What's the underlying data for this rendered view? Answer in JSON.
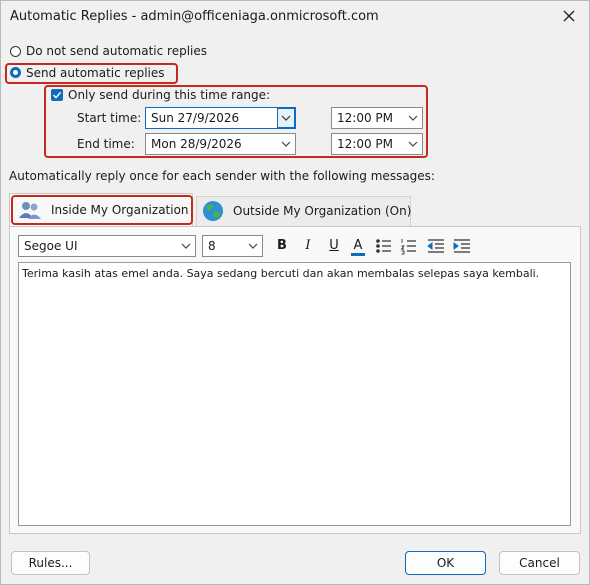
{
  "window": {
    "title": "Automatic Replies - admin@officeniaga.onmicrosoft.com"
  },
  "options": {
    "no_reply_label": "Do not send automatic replies",
    "send_label": "Send automatic replies",
    "send_selected": true,
    "time_range_label": "Only send during this time range:",
    "time_range_checked": true
  },
  "schedule": {
    "start_label": "Start time:",
    "start_date": "Sun 27/9/2026",
    "start_time": "12:00 PM",
    "end_label": "End time:",
    "end_date": "Mon 28/9/2026",
    "end_time": "12:00 PM"
  },
  "messages": {
    "caption": "Automatically reply once for each sender with the following messages:",
    "tabs": [
      {
        "label": "Inside My Organization",
        "active": true
      },
      {
        "label": "Outside My Organization (On)",
        "active": false
      }
    ]
  },
  "toolbar": {
    "font_name": "Segoe UI",
    "font_size": "8",
    "bold": "B",
    "italic": "I",
    "underline": "U",
    "font_color": "A",
    "accent": "#0f6cbd",
    "highlight": "#c42b1c"
  },
  "body_text": "Terima kasih atas emel anda. Saya sedang bercuti dan akan membalas selepas saya kembali.",
  "buttons": {
    "rules": "Rules...",
    "ok": "OK",
    "cancel": "Cancel"
  }
}
